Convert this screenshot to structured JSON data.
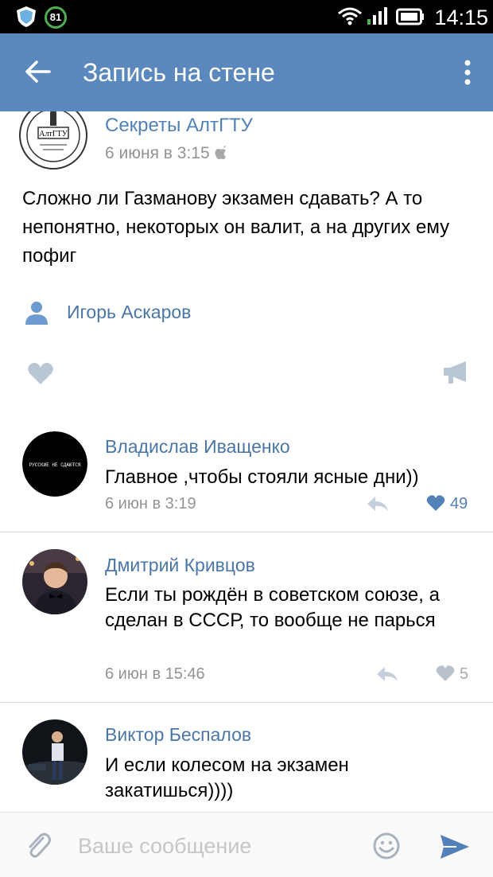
{
  "status_bar": {
    "battery_percent": "81",
    "time": "14:15",
    "icons": [
      "shield-icon",
      "wifi-icon",
      "signal-icon",
      "battery-icon"
    ]
  },
  "app_bar": {
    "title": "Запись на стене",
    "back_icon": "arrow-left-icon",
    "menu_icon": "more-vertical-icon"
  },
  "post": {
    "author": "Секреты АлтГТУ",
    "date": "6 июня в 3:15",
    "avatar_seal_text": "АлтГТУ",
    "text": "Сложно ли Газманову экзамен сдавать? А то непонятно, некоторых он валит, а на других ему пофиг",
    "signer": "Игорь Аскаров"
  },
  "comments": [
    {
      "author": "Владислав Иващенко",
      "avatar_text": "РУССКИЕ НЕ СДАЮТСЯ",
      "text": "Главное ,чтобы стояли ясные дни))",
      "time": "6 июн в 3:19",
      "likes": "49",
      "liked": true
    },
    {
      "author": "Дмитрий Кривцов",
      "text": "Если ты рождён в советском союзе, а сделан в СССР, то вообще не парься",
      "time": "6 июн в 15:46",
      "likes": "5",
      "liked": false
    },
    {
      "author": "Виктор Беспалов",
      "text": "И если колесом на экзамен закатишься))))"
    }
  ],
  "composer": {
    "placeholder": "Ваше сообщение"
  },
  "colors": {
    "header_bg": "#5b88bd",
    "link": "#4a76a8",
    "liked_heart": "#5181b8",
    "muted_gray": "#939393"
  }
}
